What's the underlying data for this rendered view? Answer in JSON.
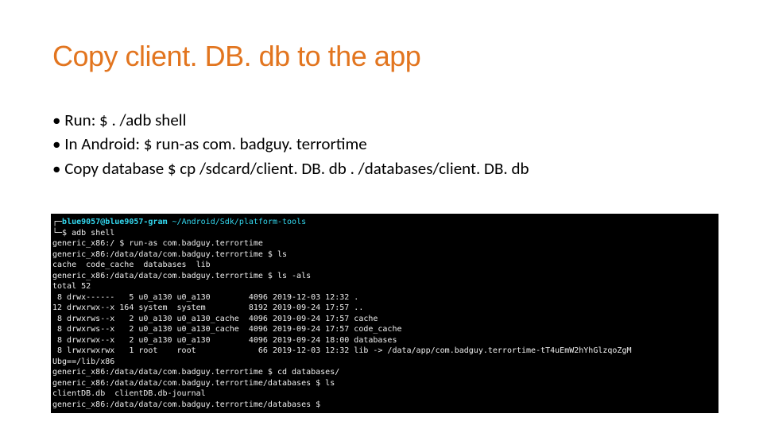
{
  "title": "Copy client. DB. db to the app",
  "bullets": {
    "b1": "Run: $ . /adb shell",
    "b2": "In Android: $ run-as com. badguy. terrortime",
    "b3": "Copy database $ cp /sdcard/client. DB. db . /databases/client. DB. db"
  },
  "term": {
    "prompt_user": "blue9057@blue9057-gram",
    "prompt_path": "~/Android/Sdk/platform-tools",
    "l1_cmd": "$ adb shell",
    "l2": "generic_x86:/ $ run-as com.badguy.terrortime",
    "l3": "generic_x86:/data/data/com.badguy.terrortime $ ls",
    "l4": "cache  code_cache  databases  lib",
    "l5": "generic_x86:/data/data/com.badguy.terrortime $ ls -als",
    "l6": "total 52",
    "l7": " 8 drwx------   5 u0_a130 u0_a130        4096 2019-12-03 12:32 .",
    "l8": "12 drwxrwx--x 164 system  system         8192 2019-09-24 17:57 ..",
    "l9": " 8 drwxrws--x   2 u0_a130 u0_a130_cache  4096 2019-09-24 17:57 cache",
    "l10": " 8 drwxrws--x   2 u0_a130 u0_a130_cache  4096 2019-09-24 17:57 code_cache",
    "l11": " 8 drwxrwx--x   2 u0_a130 u0_a130        4096 2019-09-24 18:00 databases",
    "l12": " 8 lrwxrwxrwx   1 root    root             66 2019-12-03 12:32 lib -> /data/app/com.badguy.terrortime-tT4uEmW2hYhGlzqoZgM",
    "l13": "Ubg==/lib/x86",
    "l14": "generic_x86:/data/data/com.badguy.terrortime $ cd databases/",
    "l15": "generic_x86:/data/data/com.badguy.terrortime/databases $ ls",
    "l16": "clientDB.db  clientDB.db-journal",
    "l17": "generic_x86:/data/data/com.badguy.terrortime/databases $ "
  }
}
